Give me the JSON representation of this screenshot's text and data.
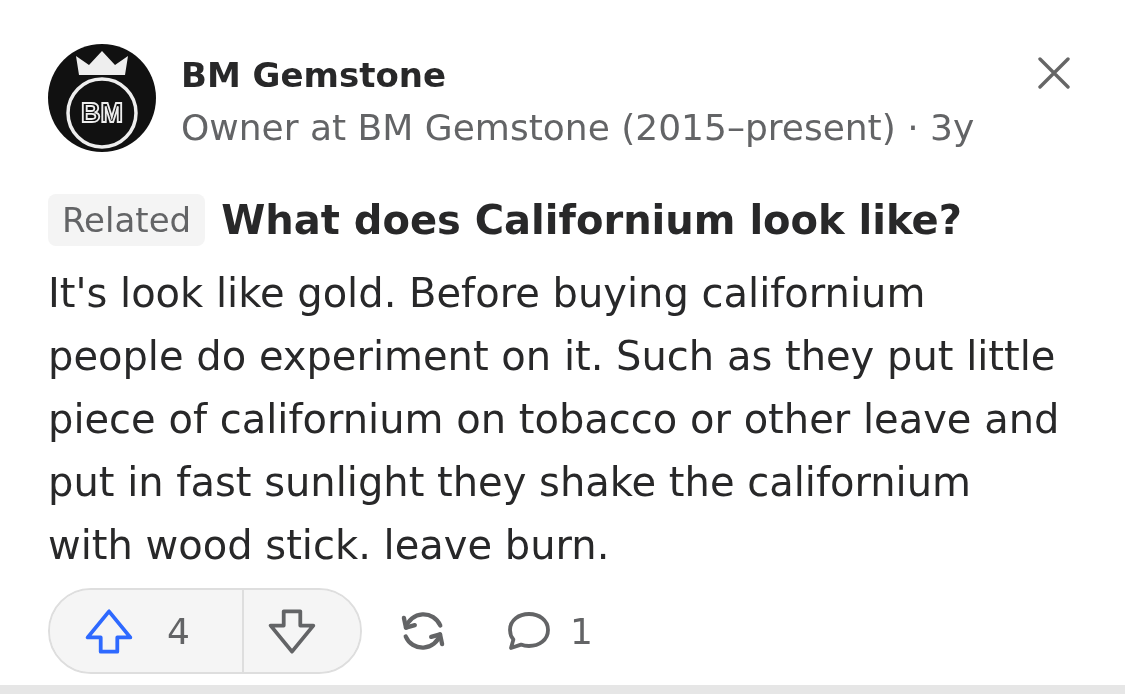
{
  "author": {
    "avatar_monogram": "BM",
    "name": "BM Gemstone",
    "meta": "Owner at BM Gemstone (2015–present) · 3y"
  },
  "related": {
    "tag": "Related",
    "question": "What does Californium look like?"
  },
  "answer": "It's look like gold. Before buying californium people do experiment on it. Such as they put little piece of californium on tobacco or other leave and put in fast sunlight they shake the californium with wood stick. leave burn.",
  "vote_bar": [
    {
      "kind": "upvote",
      "count": "4"
    },
    {
      "kind": "downvote"
    }
  ],
  "actions": [
    {
      "kind": "share"
    },
    {
      "kind": "comment",
      "count": "1"
    }
  ]
}
